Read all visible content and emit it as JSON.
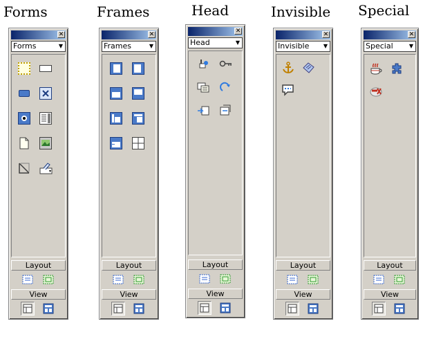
{
  "panels": [
    {
      "caption": "Forms",
      "dropdown": "Forms",
      "icons": [
        "form-icon",
        "text-field-icon",
        "button-icon",
        "checkbox-icon",
        "radio-button-icon",
        "list-menu-icon",
        "file-field-icon",
        "image-field-icon",
        "hidden-field-icon",
        "jump-menu-icon"
      ]
    },
    {
      "caption": "Frames",
      "dropdown": "Frames",
      "icons": [
        "left-frame-icon",
        "right-frame-icon",
        "top-frame-icon",
        "bottom-frame-icon",
        "left-top-frame-icon",
        "top-left-frame-icon",
        "top-bottom-frame-icon",
        "split-frame-icon"
      ]
    },
    {
      "caption": "Head",
      "dropdown": "Head",
      "icons": [
        "meta-icon",
        "keywords-icon",
        "description-icon",
        "refresh-icon",
        "base-icon",
        "link-icon"
      ]
    },
    {
      "caption": "Invisible",
      "dropdown": "Invisible",
      "icons": [
        "named-anchor-icon",
        "script-icon",
        "comment-icon"
      ]
    },
    {
      "caption": "Special",
      "dropdown": "Special",
      "icons": [
        "applet-icon",
        "plugin-icon",
        "activex-icon"
      ]
    }
  ],
  "layout_label": "Layout",
  "view_label": "View",
  "close_glyph": "✕",
  "dropdown_arrow": "▼",
  "layout_buttons": [
    "draw-layer-icon",
    "draw-layout-cell-icon"
  ],
  "view_buttons": [
    "standard-view-icon",
    "layout-view-icon"
  ]
}
